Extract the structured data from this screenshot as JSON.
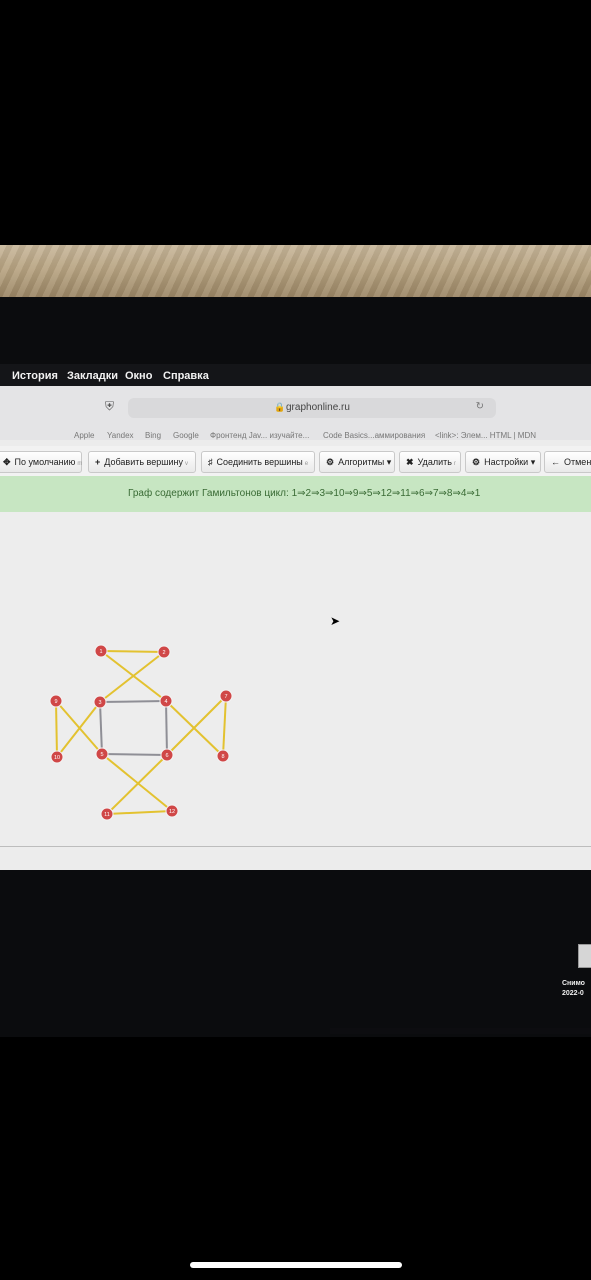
{
  "menubar": {
    "items": [
      "История",
      "Закладки",
      "Окно",
      "Справка"
    ]
  },
  "browser": {
    "url": "graphonline.ru",
    "bookmarks": [
      "Apple",
      "Yandex",
      "Bing",
      "Google",
      "Фронтенд Jav... изучайте...",
      "Code Basics...аммирования",
      "<link>: Элем... HTML | MDN"
    ]
  },
  "toolbar": {
    "default_label": "По умолчанию",
    "default_hint": "m",
    "add_vertex_label": "Добавить вершину",
    "add_vertex_hint": "v",
    "connect_label": "Соединить вершины",
    "connect_hint": "e",
    "algorithms_label": "Алгоритмы ▾",
    "delete_label": "Удалить",
    "delete_hint": "r",
    "settings_label": "Настройки ▾",
    "undo_label": "Отмени"
  },
  "banner": {
    "text": "Граф содержит Гамильтонов цикл: 1⇒2⇒3⇒10⇒9⇒5⇒12⇒11⇒6⇒7⇒8⇒4⇒1"
  },
  "graph": {
    "vertex_color": "#d04747",
    "highlight_edge_color": "#e3c230",
    "plain_edge_color": "#8f8f96",
    "vertices": [
      {
        "id": "1"
      },
      {
        "id": "2"
      },
      {
        "id": "3"
      },
      {
        "id": "4"
      },
      {
        "id": "5"
      },
      {
        "id": "6"
      },
      {
        "id": "7"
      },
      {
        "id": "8"
      },
      {
        "id": "9"
      },
      {
        "id": "10"
      },
      {
        "id": "11"
      },
      {
        "id": "12"
      }
    ],
    "edges": [
      {
        "from": "1",
        "to": "2",
        "in_cycle": true
      },
      {
        "from": "2",
        "to": "3",
        "in_cycle": true
      },
      {
        "from": "1",
        "to": "4",
        "in_cycle": true
      },
      {
        "from": "3",
        "to": "10",
        "in_cycle": true
      },
      {
        "from": "10",
        "to": "9",
        "in_cycle": true
      },
      {
        "from": "9",
        "to": "5",
        "in_cycle": true
      },
      {
        "from": "5",
        "to": "12",
        "in_cycle": true
      },
      {
        "from": "12",
        "to": "11",
        "in_cycle": true
      },
      {
        "from": "11",
        "to": "6",
        "in_cycle": true
      },
      {
        "from": "6",
        "to": "7",
        "in_cycle": true
      },
      {
        "from": "7",
        "to": "8",
        "in_cycle": true
      },
      {
        "from": "8",
        "to": "4",
        "in_cycle": true
      },
      {
        "from": "3",
        "to": "4",
        "in_cycle": false
      },
      {
        "from": "4",
        "to": "6",
        "in_cycle": false
      },
      {
        "from": "6",
        "to": "5",
        "in_cycle": false
      },
      {
        "from": "5",
        "to": "3",
        "in_cycle": false
      }
    ]
  },
  "side": {
    "line1": "Снимо",
    "line2": "2022-0"
  }
}
